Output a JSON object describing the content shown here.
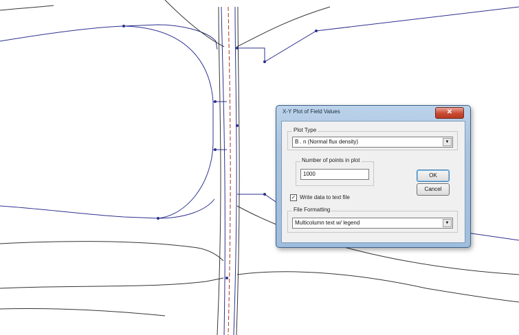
{
  "dialog": {
    "title": "X-Y Plot of Field Values",
    "close_glyph": "✕",
    "plot_type": {
      "label": "Plot Type",
      "selected": "B . n   (Normal flux density)"
    },
    "num_points": {
      "label": "Number of points in plot",
      "value": "1000"
    },
    "ok_label": "OK",
    "cancel_label": "Cancel",
    "write_checkbox": {
      "checked_glyph": "✓",
      "label": "Write data to text file",
      "checked": true
    },
    "file_formatting": {
      "label": "File Formatting",
      "selected": "Multicolumn text w/ legend"
    },
    "dropdown_glyph": "▼"
  },
  "colors": {
    "contour": "#2b2f8c",
    "boundary": "#1f1f1f",
    "centerline": "#b03020"
  }
}
